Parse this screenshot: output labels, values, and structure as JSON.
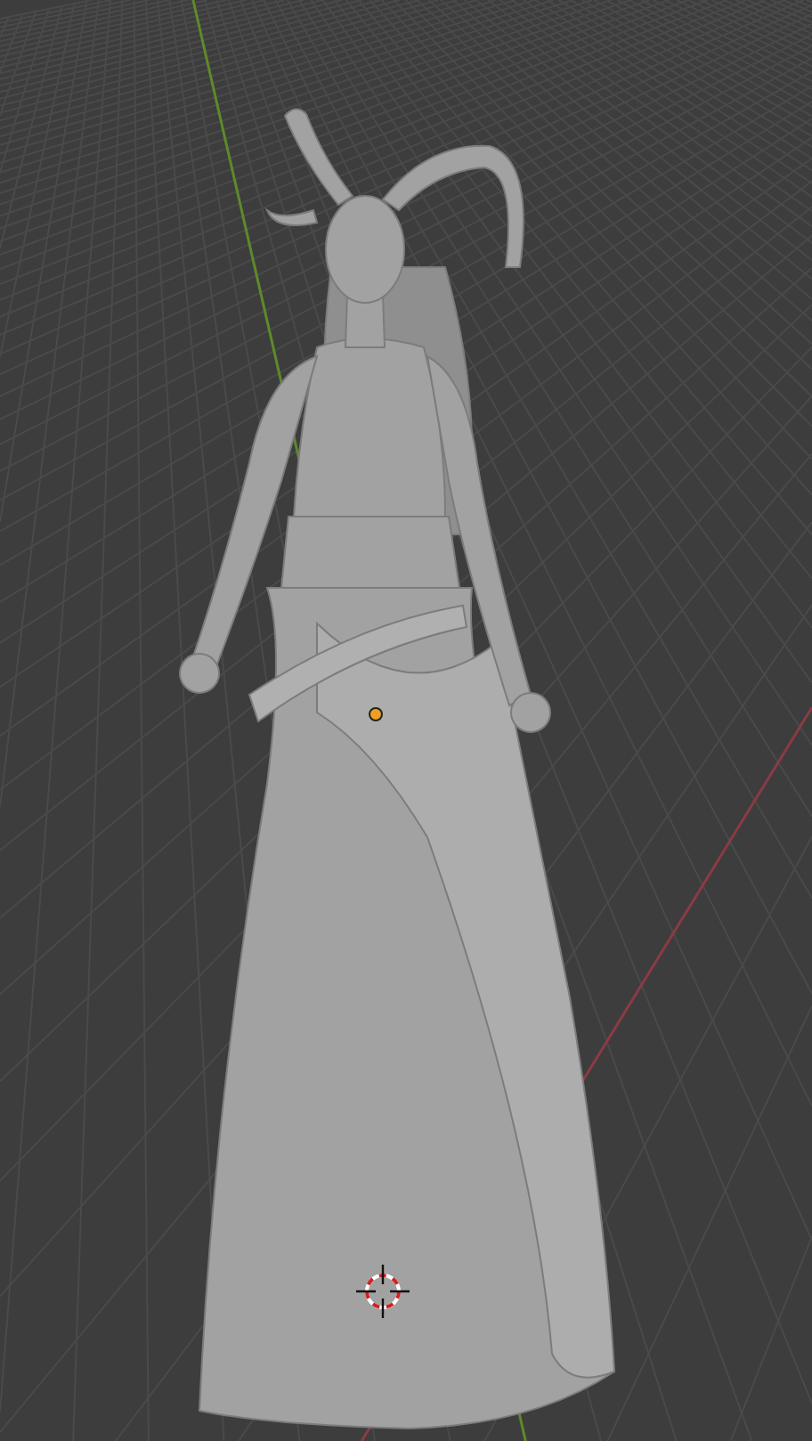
{
  "viewport": {
    "grid_visible": true,
    "x_axis_visible": true,
    "y_axis_visible": true,
    "origin_visible": true,
    "cursor_visible": true
  }
}
